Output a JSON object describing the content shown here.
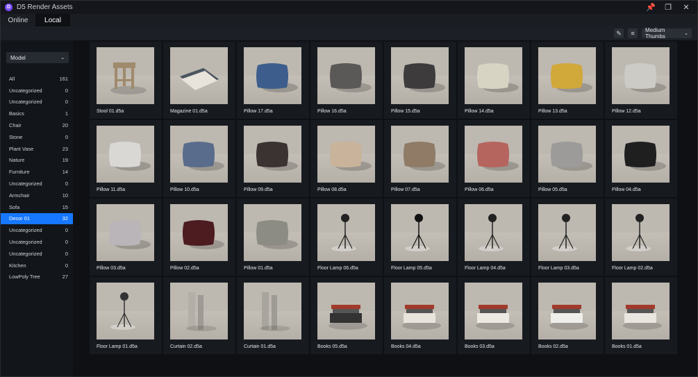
{
  "window": {
    "title": "D5 Render Assets",
    "app_icon_letter": "D",
    "controls": [
      "pin-icon",
      "restore-icon",
      "close-icon"
    ]
  },
  "tabs": [
    {
      "label": "Online",
      "active": false
    },
    {
      "label": "Local",
      "active": true
    }
  ],
  "toolbar": {
    "view_mode": "Medium Thumbs"
  },
  "sidebar": {
    "type_select": "Model",
    "categories": [
      {
        "label": "All",
        "count": "161"
      },
      {
        "label": "Uncategorized",
        "count": "0"
      },
      {
        "label": "Uncategorized",
        "count": "0"
      },
      {
        "label": "Basics",
        "count": "1"
      },
      {
        "label": "Chair",
        "count": "20"
      },
      {
        "label": "Stone",
        "count": "0"
      },
      {
        "label": "Plant Vase",
        "count": "23"
      },
      {
        "label": "Nature",
        "count": "19"
      },
      {
        "label": "Furniture",
        "count": "14"
      },
      {
        "label": "Uncategorized",
        "count": "0"
      },
      {
        "label": "Armchair",
        "count": "10"
      },
      {
        "label": "Sofa",
        "count": "15"
      },
      {
        "label": "Decor 01",
        "count": "32",
        "active": true
      },
      {
        "label": "Uncategorized",
        "count": "0"
      },
      {
        "label": "Uncategorized",
        "count": "0"
      },
      {
        "label": "Uncategorized",
        "count": "0"
      },
      {
        "label": "Kitchen",
        "count": "0"
      },
      {
        "label": "LowPoly Tree",
        "count": "27"
      }
    ]
  },
  "assets": [
    {
      "name": "Stool 01.d5a",
      "kind": "stool",
      "color": "#a08a6c"
    },
    {
      "name": "Magazine 01.d5a",
      "kind": "magazine",
      "color": "#4a5560"
    },
    {
      "name": "Pillow 17.d5a",
      "kind": "pillow",
      "color": "#3d5e8c"
    },
    {
      "name": "Pillow 16.d5a",
      "kind": "pillow",
      "color": "#5b5957"
    },
    {
      "name": "Pillow 15.d5a",
      "kind": "pillow",
      "color": "#3e3b3d"
    },
    {
      "name": "Pillow 14.d5a",
      "kind": "pillow",
      "color": "#d8d4c4"
    },
    {
      "name": "Pillow 13.d5a",
      "kind": "pillow",
      "color": "#d1a83a"
    },
    {
      "name": "Pillow 12.d5a",
      "kind": "pillow",
      "color": "#cdcbc6"
    },
    {
      "name": "Pillow 11.d5a",
      "kind": "pillow",
      "color": "#d9d8d5"
    },
    {
      "name": "Pillow 10.d5a",
      "kind": "pillow",
      "color": "#5a6c8c"
    },
    {
      "name": "Pillow 09.d5a",
      "kind": "pillow",
      "color": "#3b3232"
    },
    {
      "name": "Pillow 08.d5a",
      "kind": "pillow",
      "color": "#c9b49b"
    },
    {
      "name": "Pillow 07.d5a",
      "kind": "pillow",
      "color": "#8f7b66"
    },
    {
      "name": "Pillow 06.d5a",
      "kind": "pillow",
      "color": "#b5645e"
    },
    {
      "name": "Pillow 05.d5a",
      "kind": "pillow",
      "color": "#9d9b99"
    },
    {
      "name": "Pillow 04.d5a",
      "kind": "pillow",
      "color": "#1f1f20"
    },
    {
      "name": "Pillow 03.d5a",
      "kind": "pillow",
      "color": "#b9b5b8"
    },
    {
      "name": "Pillow 02.d5a",
      "kind": "pillow",
      "color": "#4c1c20"
    },
    {
      "name": "Pillow 01.d5a",
      "kind": "pillow",
      "color": "#8d8c84"
    },
    {
      "name": "Floor Lamp 06.d5a",
      "kind": "lamp",
      "color": "#222"
    },
    {
      "name": "Floor Lamp 05.d5a",
      "kind": "lamp",
      "color": "#111"
    },
    {
      "name": "Floor Lamp 04.d5a",
      "kind": "lamp",
      "color": "#222"
    },
    {
      "name": "Floor Lamp 03.d5a",
      "kind": "lamp",
      "color": "#222"
    },
    {
      "name": "Floor Lamp 02.d5a",
      "kind": "lamp",
      "color": "#222"
    },
    {
      "name": "Floor Lamp 01.d5a",
      "kind": "lamp",
      "color": "#333"
    },
    {
      "name": "Curtain 02.d5a",
      "kind": "curtain",
      "color": "#b3afa8"
    },
    {
      "name": "Curtain 01.d5a",
      "kind": "curtain",
      "color": "#a8a49e"
    },
    {
      "name": "Books 05.d5a",
      "kind": "books",
      "color": "#333"
    },
    {
      "name": "Books 04.d5a",
      "kind": "books",
      "color": "#e8e4dc"
    },
    {
      "name": "Books 03.d5a",
      "kind": "books",
      "color": "#ece9e3"
    },
    {
      "name": "Books 02.d5a",
      "kind": "books",
      "color": "#f0eeea"
    },
    {
      "name": "Books 01.d5a",
      "kind": "books",
      "color": "#e9e6e0"
    }
  ]
}
